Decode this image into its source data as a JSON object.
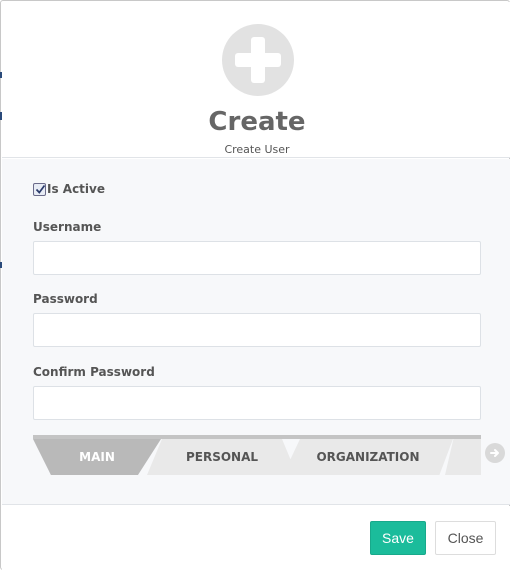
{
  "header": {
    "icon": "plus-icon",
    "title": "Create",
    "subtitle": "Create User"
  },
  "form": {
    "is_active": {
      "label": "Is Active",
      "checked": true
    },
    "username": {
      "label": "Username",
      "value": "",
      "placeholder": ""
    },
    "password": {
      "label": "Password",
      "value": "",
      "placeholder": ""
    },
    "confirm_password": {
      "label": "Confirm Password",
      "value": "",
      "placeholder": ""
    }
  },
  "tabs": [
    {
      "label": "MAIN",
      "active": true
    },
    {
      "label": "PERSONAL",
      "active": false
    },
    {
      "label": "ORGANIZATION",
      "active": false
    }
  ],
  "tabs_next_icon": "circle-arrow-right-icon",
  "footer": {
    "save_label": "Save",
    "close_label": "Close"
  },
  "colors": {
    "accent": "#1bbc9b",
    "active_tab": "#b9b9b9",
    "inactive_tab": "#e9e9e9",
    "body_background": "#f7f8fa"
  }
}
